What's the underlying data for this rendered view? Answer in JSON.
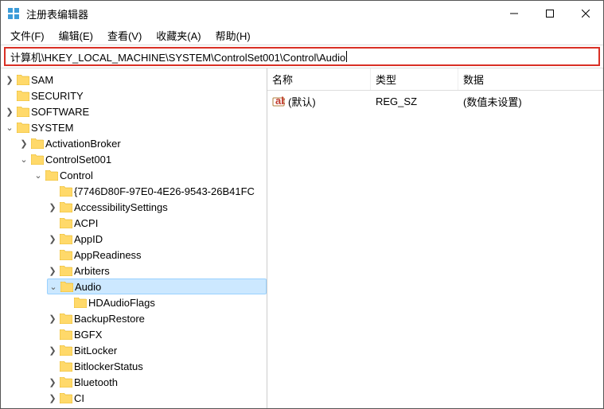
{
  "window": {
    "title": "注册表编辑器"
  },
  "menu": {
    "items": [
      "文件(F)",
      "编辑(E)",
      "查看(V)",
      "收藏夹(A)",
      "帮助(H)"
    ]
  },
  "addressbar": {
    "path": "计算机\\HKEY_LOCAL_MACHINE\\SYSTEM\\ControlSet001\\Control\\Audio"
  },
  "list": {
    "headers": {
      "name": "名称",
      "type": "类型",
      "data": "数据"
    },
    "rows": {
      "0": {
        "name": "(默认)",
        "type": "REG_SZ",
        "data": "(数值未设置)"
      }
    }
  },
  "tree": {
    "sam": "SAM",
    "security": "SECURITY",
    "software": "SOFTWARE",
    "system": "SYSTEM",
    "activationbroker": "ActivationBroker",
    "controlset001": "ControlSet001",
    "control": "Control",
    "guid": "{7746D80F-97E0-4E26-9543-26B41FC",
    "accessibility": "AccessibilitySettings",
    "acpi": "ACPI",
    "appid": "AppID",
    "appreadiness": "AppReadiness",
    "arbiters": "Arbiters",
    "audio": "Audio",
    "hdaudioflags": "HDAudioFlags",
    "backuprestore": "BackupRestore",
    "bgfx": "BGFX",
    "bitlocker": "BitLocker",
    "bitlockerstatus": "BitlockerStatus",
    "bluetooth": "Bluetooth",
    "ci": "CI"
  }
}
